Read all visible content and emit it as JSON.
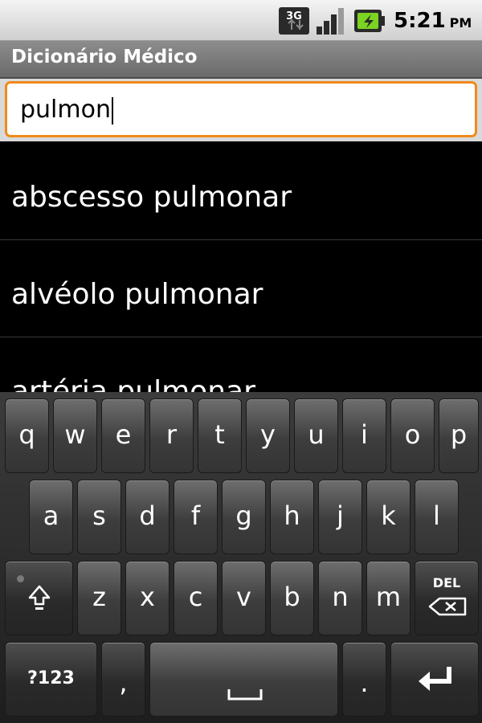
{
  "status_bar": {
    "network_icon": "3g-icon",
    "signal_icon": "signal-icon",
    "battery_icon": "battery-charging-icon",
    "time": "5:21",
    "ampm": "PM"
  },
  "app": {
    "title": "Dicionário Médico"
  },
  "search": {
    "value": "pulmon"
  },
  "results": [
    {
      "label": "abscesso pulmonar"
    },
    {
      "label": "alvéolo pulmonar"
    },
    {
      "label": "artéria pulmonar"
    }
  ],
  "keyboard": {
    "row1": [
      "q",
      "w",
      "e",
      "r",
      "t",
      "y",
      "u",
      "i",
      "o",
      "p"
    ],
    "row2": [
      "a",
      "s",
      "d",
      "f",
      "g",
      "h",
      "j",
      "k",
      "l"
    ],
    "row3": [
      "z",
      "x",
      "c",
      "v",
      "b",
      "n",
      "m"
    ],
    "symbols_label": "?123",
    "comma_label": ",",
    "period_label": ".",
    "delete_label": "DEL",
    "accent_color": "#f08a1c"
  }
}
